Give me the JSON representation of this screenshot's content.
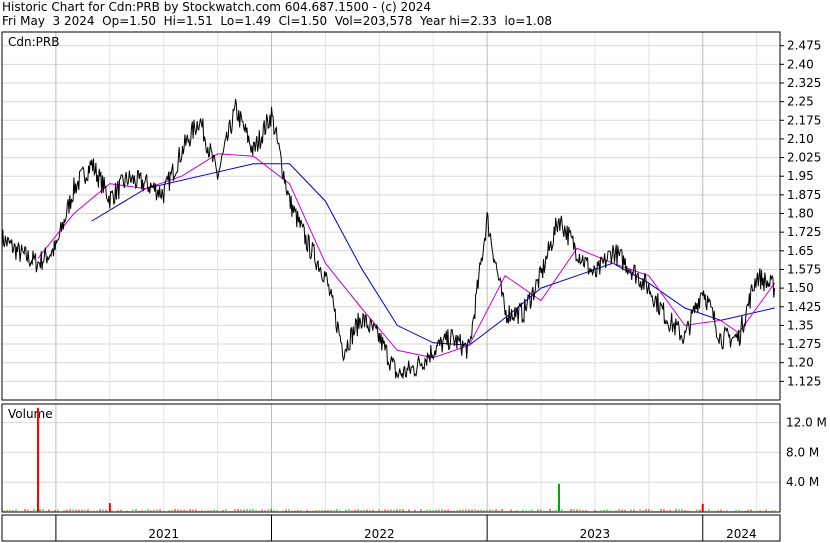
{
  "header": {
    "title": "Historic Chart for Cdn:PRB by Stockwatch.com 604.687.1500 - (c) 2024",
    "summary": "Fri May  3 2024  Op=1.50  Hi=1.51  Lo=1.49  Cl=1.50  Vol=203,578  Year hi=2.33  lo=1.08"
  },
  "chart_data": [
    {
      "type": "line",
      "panel": "price",
      "symbol_label": "Cdn:PRB",
      "ylim": [
        1.05,
        2.53
      ],
      "y_ticks": [
        "2.475",
        "2.40",
        "2.325",
        "2.25",
        "2.175",
        "2.10",
        "2.025",
        "1.95",
        "1.875",
        "1.80",
        "1.725",
        "1.65",
        "1.575",
        "1.50",
        "1.425",
        "1.35",
        "1.275",
        "1.20",
        "1.125"
      ],
      "x_ticks": [
        "2021",
        "2022",
        "2023",
        "2024"
      ],
      "grid": true,
      "colors": {
        "price": "#000000",
        "ma_short": "#cc00cc",
        "ma_long": "#0000cc"
      },
      "price_path": [
        {
          "x": "2020-10",
          "y": 1.7
        },
        {
          "x": "2020-11",
          "y": 1.64
        },
        {
          "x": "2020-12",
          "y": 1.6
        },
        {
          "x": "2021-01",
          "y": 1.66
        },
        {
          "x": "2021-02",
          "y": 1.9
        },
        {
          "x": "2021-03",
          "y": 2.0
        },
        {
          "x": "2021-04",
          "y": 1.86
        },
        {
          "x": "2021-05",
          "y": 1.94
        },
        {
          "x": "2021-06",
          "y": 1.92
        },
        {
          "x": "2021-07",
          "y": 1.88
        },
        {
          "x": "2021-08",
          "y": 2.05
        },
        {
          "x": "2021-09",
          "y": 2.18
        },
        {
          "x": "2021-10",
          "y": 1.95
        },
        {
          "x": "2021-11",
          "y": 2.22
        },
        {
          "x": "2021-12",
          "y": 2.05
        },
        {
          "x": "2022-01",
          "y": 2.2
        },
        {
          "x": "2022-02",
          "y": 1.85
        },
        {
          "x": "2022-03",
          "y": 1.68
        },
        {
          "x": "2022-04",
          "y": 1.55
        },
        {
          "x": "2022-05",
          "y": 1.25
        },
        {
          "x": "2022-06",
          "y": 1.38
        },
        {
          "x": "2022-07",
          "y": 1.3
        },
        {
          "x": "2022-08",
          "y": 1.15
        },
        {
          "x": "2022-09",
          "y": 1.18
        },
        {
          "x": "2022-10",
          "y": 1.25
        },
        {
          "x": "2022-11",
          "y": 1.3
        },
        {
          "x": "2022-12",
          "y": 1.25
        },
        {
          "x": "2023-01",
          "y": 1.78
        },
        {
          "x": "2023-02",
          "y": 1.4
        },
        {
          "x": "2023-03",
          "y": 1.4
        },
        {
          "x": "2023-04",
          "y": 1.55
        },
        {
          "x": "2023-05",
          "y": 1.78
        },
        {
          "x": "2023-06",
          "y": 1.65
        },
        {
          "x": "2023-07",
          "y": 1.55
        },
        {
          "x": "2023-08",
          "y": 1.65
        },
        {
          "x": "2023-09",
          "y": 1.58
        },
        {
          "x": "2023-10",
          "y": 1.5
        },
        {
          "x": "2023-11",
          "y": 1.38
        },
        {
          "x": "2023-12",
          "y": 1.3
        },
        {
          "x": "2024-01",
          "y": 1.5
        },
        {
          "x": "2024-02",
          "y": 1.3
        },
        {
          "x": "2024-03",
          "y": 1.3
        },
        {
          "x": "2024-04",
          "y": 1.55
        },
        {
          "x": "2024-05",
          "y": 1.5
        }
      ],
      "ma_short": [
        {
          "x": "2020-12",
          "y": 1.62
        },
        {
          "x": "2021-02",
          "y": 1.8
        },
        {
          "x": "2021-04",
          "y": 1.92
        },
        {
          "x": "2021-06",
          "y": 1.9
        },
        {
          "x": "2021-08",
          "y": 1.95
        },
        {
          "x": "2021-10",
          "y": 2.04
        },
        {
          "x": "2021-12",
          "y": 2.03
        },
        {
          "x": "2022-02",
          "y": 1.92
        },
        {
          "x": "2022-04",
          "y": 1.6
        },
        {
          "x": "2022-06",
          "y": 1.42
        },
        {
          "x": "2022-08",
          "y": 1.25
        },
        {
          "x": "2022-10",
          "y": 1.22
        },
        {
          "x": "2022-12",
          "y": 1.27
        },
        {
          "x": "2023-02",
          "y": 1.55
        },
        {
          "x": "2023-04",
          "y": 1.45
        },
        {
          "x": "2023-06",
          "y": 1.66
        },
        {
          "x": "2023-08",
          "y": 1.6
        },
        {
          "x": "2023-10",
          "y": 1.55
        },
        {
          "x": "2023-12",
          "y": 1.35
        },
        {
          "x": "2024-02",
          "y": 1.37
        },
        {
          "x": "2024-03",
          "y": 1.32
        },
        {
          "x": "2024-05",
          "y": 1.52
        }
      ],
      "ma_long": [
        {
          "x": "2021-03",
          "y": 1.77
        },
        {
          "x": "2021-06",
          "y": 1.9
        },
        {
          "x": "2021-09",
          "y": 1.95
        },
        {
          "x": "2021-12",
          "y": 2.0
        },
        {
          "x": "2022-02",
          "y": 2.0
        },
        {
          "x": "2022-04",
          "y": 1.85
        },
        {
          "x": "2022-06",
          "y": 1.58
        },
        {
          "x": "2022-08",
          "y": 1.35
        },
        {
          "x": "2022-10",
          "y": 1.28
        },
        {
          "x": "2022-12",
          "y": 1.27
        },
        {
          "x": "2023-02",
          "y": 1.38
        },
        {
          "x": "2023-04",
          "y": 1.5
        },
        {
          "x": "2023-06",
          "y": 1.55
        },
        {
          "x": "2023-08",
          "y": 1.6
        },
        {
          "x": "2023-10",
          "y": 1.52
        },
        {
          "x": "2023-12",
          "y": 1.42
        },
        {
          "x": "2024-02",
          "y": 1.37
        },
        {
          "x": "2024-05",
          "y": 1.42
        }
      ]
    },
    {
      "type": "bar",
      "panel": "volume",
      "title": "Volume",
      "ylim": [
        0,
        14.5
      ],
      "y_ticks": [
        "12.0 M",
        "8.0 M",
        "4.0 M"
      ],
      "tick_values": [
        12,
        8,
        4
      ],
      "unit": "M",
      "spikes": [
        {
          "x": "2020-12",
          "value": 14.0,
          "color": "#ee0000"
        },
        {
          "x": "2021-04",
          "value": 1.2,
          "color": "#ee0000"
        },
        {
          "x": "2023-05",
          "value": 3.8,
          "color": "#00aa00"
        },
        {
          "x": "2024-01",
          "value": 1.1,
          "color": "#ee0000"
        }
      ],
      "base_volume": 0.3
    }
  ]
}
